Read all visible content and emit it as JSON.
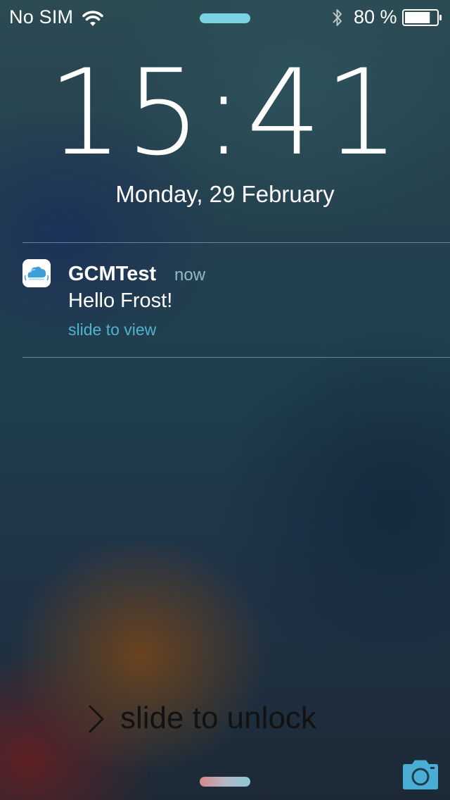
{
  "status_bar": {
    "carrier": "No SIM",
    "battery_percent": "80 %",
    "battery_level": 0.8,
    "icons": [
      "wifi-icon",
      "bluetooth-icon",
      "battery-icon"
    ],
    "grabber_color": "#7ad3e2"
  },
  "lock_screen": {
    "time": "15:41",
    "date": "Monday, 29 February"
  },
  "notification": {
    "app_name": "GCMTest",
    "time": "now",
    "message": "Hello Frost!",
    "action": "slide to view",
    "icon": "cloud-icon",
    "action_color": "#4fb4cf"
  },
  "unlock": {
    "label": "slide to unlock",
    "icon": "chevron-right-icon"
  },
  "camera": {
    "icon": "camera-icon",
    "color": "#4aaed4"
  }
}
